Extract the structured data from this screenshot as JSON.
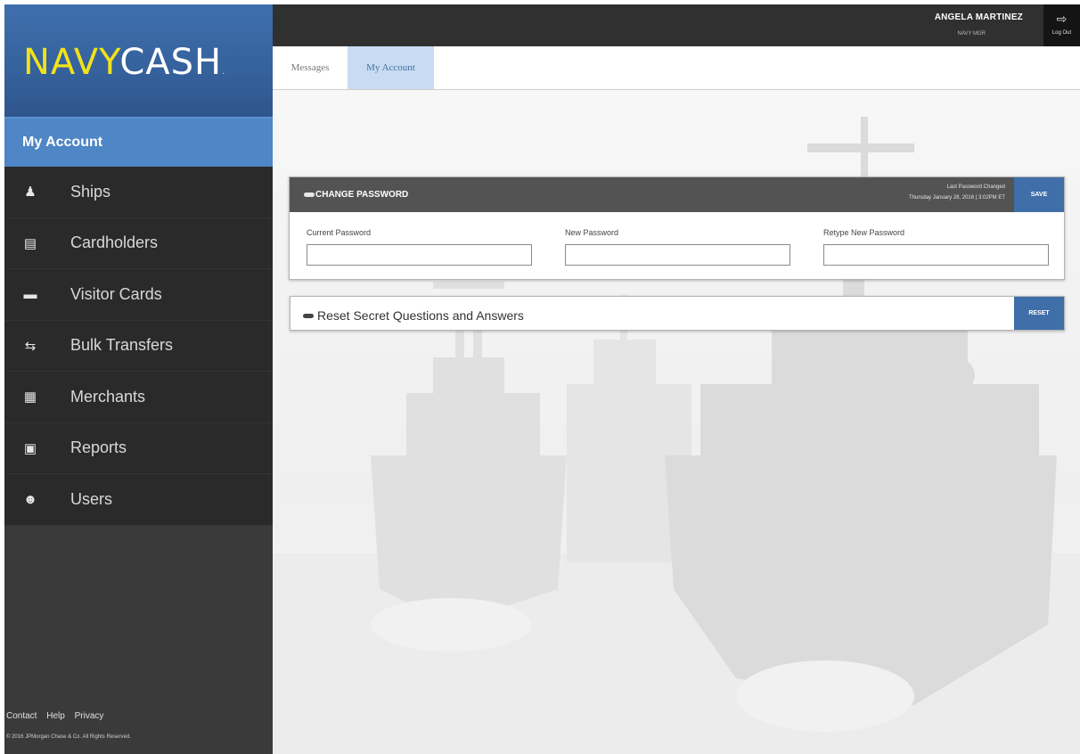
{
  "brand": {
    "navy": "NAVY",
    "cash": "CASH",
    "dot": "."
  },
  "sidebar": {
    "active_label": "My Account",
    "items": [
      {
        "label": "Ships",
        "icon": "ship-icon",
        "glyph": "♟"
      },
      {
        "label": "Cardholders",
        "icon": "cardholders-icon",
        "glyph": "▤"
      },
      {
        "label": "Visitor Cards",
        "icon": "visitor-card-icon",
        "glyph": "▬"
      },
      {
        "label": "Bulk Transfers",
        "icon": "bulk-transfer-icon",
        "glyph": "⇆"
      },
      {
        "label": "Merchants",
        "icon": "merchant-icon",
        "glyph": "▦"
      },
      {
        "label": "Reports",
        "icon": "report-icon",
        "glyph": "▣"
      },
      {
        "label": "Users",
        "icon": "users-icon",
        "glyph": "☻"
      }
    ],
    "footer": {
      "links": [
        "Contact",
        "Help",
        "Privacy"
      ],
      "copyright": "© 2016 JPMorgan Chase & Co. All Rights Reserved."
    }
  },
  "header": {
    "user_name": "ANGELA MARTINEZ",
    "user_role": "NAVY MGR",
    "logout_label": "Log Out"
  },
  "tabs": [
    {
      "label": "Messages",
      "active": false
    },
    {
      "label": "My Account",
      "active": true
    }
  ],
  "change_password": {
    "title": "CHANGE PASSWORD",
    "last_changed_label": "Last Password Changed",
    "last_changed_value": "Thursday January 28, 2016 | 3:02PM ET",
    "save_label": "SAVE",
    "fields": [
      {
        "label": "Current Password",
        "value": ""
      },
      {
        "label": "New Password",
        "value": ""
      },
      {
        "label": "Retype New Password",
        "value": ""
      }
    ]
  },
  "reset_questions": {
    "title": "Reset Secret Questions and Answers",
    "reset_label": "RESET"
  },
  "colors": {
    "brand_yellow": "#f2e21a",
    "sidebar_active": "#4e86c6",
    "button_blue": "#3f6ea9",
    "panel_header": "#535353"
  }
}
